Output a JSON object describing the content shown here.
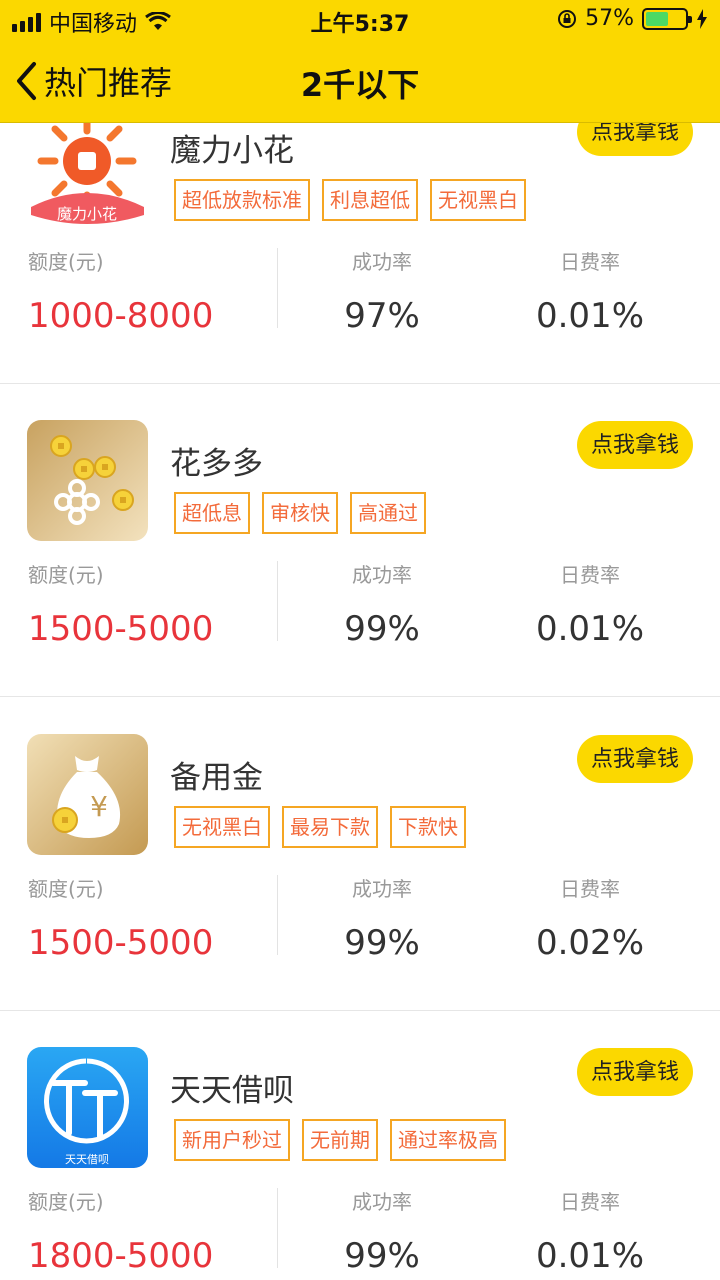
{
  "status_bar": {
    "carrier": "中国移动",
    "time": "上午5:37",
    "battery_percent": "57%",
    "battery_level": 0.57
  },
  "navbar": {
    "back_label": "热门推荐",
    "title": "2千以下"
  },
  "labels": {
    "amount": "额度(元)",
    "success_rate": "成功率",
    "daily_rate": "日费率",
    "cta": "点我拿钱"
  },
  "colors": {
    "brand_yellow": "#fbd800",
    "amount_red": "#e8343b",
    "tag_border": "#f5a623",
    "tag_text": "#f36b3b"
  },
  "products": [
    {
      "name": "魔力小花",
      "logo_text": "魔力小花",
      "icon": "sun-coin-logo-icon",
      "tags": [
        "超低放款标准",
        "利息超低",
        "无视黑白"
      ],
      "amount": "1000-8000",
      "success_rate": "97%",
      "daily_rate": "0.01%"
    },
    {
      "name": "花多多",
      "icon": "gold-coins-flower-logo-icon",
      "tags": [
        "超低息",
        "审核快",
        "高通过"
      ],
      "amount": "1500-5000",
      "success_rate": "99%",
      "daily_rate": "0.01%"
    },
    {
      "name": "备用金",
      "icon": "money-bag-logo-icon",
      "tags": [
        "无视黑白",
        "最易下款",
        "下款快"
      ],
      "amount": "1500-5000",
      "success_rate": "99%",
      "daily_rate": "0.02%"
    },
    {
      "name": "天天借呗",
      "logo_text": "天天借呗",
      "icon": "tt-logo-icon",
      "tags": [
        "新用户秒过",
        "无前期",
        "通过率极高"
      ],
      "amount": "1800-5000",
      "success_rate": "99%",
      "daily_rate": "0.01%"
    }
  ]
}
